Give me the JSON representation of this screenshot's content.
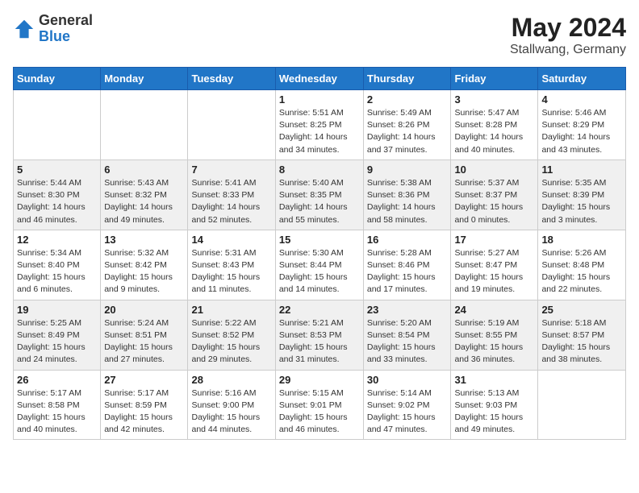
{
  "header": {
    "logo_general": "General",
    "logo_blue": "Blue",
    "month_year": "May 2024",
    "location": "Stallwang, Germany"
  },
  "days_of_week": [
    "Sunday",
    "Monday",
    "Tuesday",
    "Wednesday",
    "Thursday",
    "Friday",
    "Saturday"
  ],
  "weeks": [
    [
      {
        "day": "",
        "info": ""
      },
      {
        "day": "",
        "info": ""
      },
      {
        "day": "",
        "info": ""
      },
      {
        "day": "1",
        "info": "Sunrise: 5:51 AM\nSunset: 8:25 PM\nDaylight: 14 hours\nand 34 minutes."
      },
      {
        "day": "2",
        "info": "Sunrise: 5:49 AM\nSunset: 8:26 PM\nDaylight: 14 hours\nand 37 minutes."
      },
      {
        "day": "3",
        "info": "Sunrise: 5:47 AM\nSunset: 8:28 PM\nDaylight: 14 hours\nand 40 minutes."
      },
      {
        "day": "4",
        "info": "Sunrise: 5:46 AM\nSunset: 8:29 PM\nDaylight: 14 hours\nand 43 minutes."
      }
    ],
    [
      {
        "day": "5",
        "info": "Sunrise: 5:44 AM\nSunset: 8:30 PM\nDaylight: 14 hours\nand 46 minutes."
      },
      {
        "day": "6",
        "info": "Sunrise: 5:43 AM\nSunset: 8:32 PM\nDaylight: 14 hours\nand 49 minutes."
      },
      {
        "day": "7",
        "info": "Sunrise: 5:41 AM\nSunset: 8:33 PM\nDaylight: 14 hours\nand 52 minutes."
      },
      {
        "day": "8",
        "info": "Sunrise: 5:40 AM\nSunset: 8:35 PM\nDaylight: 14 hours\nand 55 minutes."
      },
      {
        "day": "9",
        "info": "Sunrise: 5:38 AM\nSunset: 8:36 PM\nDaylight: 14 hours\nand 58 minutes."
      },
      {
        "day": "10",
        "info": "Sunrise: 5:37 AM\nSunset: 8:37 PM\nDaylight: 15 hours\nand 0 minutes."
      },
      {
        "day": "11",
        "info": "Sunrise: 5:35 AM\nSunset: 8:39 PM\nDaylight: 15 hours\nand 3 minutes."
      }
    ],
    [
      {
        "day": "12",
        "info": "Sunrise: 5:34 AM\nSunset: 8:40 PM\nDaylight: 15 hours\nand 6 minutes."
      },
      {
        "day": "13",
        "info": "Sunrise: 5:32 AM\nSunset: 8:42 PM\nDaylight: 15 hours\nand 9 minutes."
      },
      {
        "day": "14",
        "info": "Sunrise: 5:31 AM\nSunset: 8:43 PM\nDaylight: 15 hours\nand 11 minutes."
      },
      {
        "day": "15",
        "info": "Sunrise: 5:30 AM\nSunset: 8:44 PM\nDaylight: 15 hours\nand 14 minutes."
      },
      {
        "day": "16",
        "info": "Sunrise: 5:28 AM\nSunset: 8:46 PM\nDaylight: 15 hours\nand 17 minutes."
      },
      {
        "day": "17",
        "info": "Sunrise: 5:27 AM\nSunset: 8:47 PM\nDaylight: 15 hours\nand 19 minutes."
      },
      {
        "day": "18",
        "info": "Sunrise: 5:26 AM\nSunset: 8:48 PM\nDaylight: 15 hours\nand 22 minutes."
      }
    ],
    [
      {
        "day": "19",
        "info": "Sunrise: 5:25 AM\nSunset: 8:49 PM\nDaylight: 15 hours\nand 24 minutes."
      },
      {
        "day": "20",
        "info": "Sunrise: 5:24 AM\nSunset: 8:51 PM\nDaylight: 15 hours\nand 27 minutes."
      },
      {
        "day": "21",
        "info": "Sunrise: 5:22 AM\nSunset: 8:52 PM\nDaylight: 15 hours\nand 29 minutes."
      },
      {
        "day": "22",
        "info": "Sunrise: 5:21 AM\nSunset: 8:53 PM\nDaylight: 15 hours\nand 31 minutes."
      },
      {
        "day": "23",
        "info": "Sunrise: 5:20 AM\nSunset: 8:54 PM\nDaylight: 15 hours\nand 33 minutes."
      },
      {
        "day": "24",
        "info": "Sunrise: 5:19 AM\nSunset: 8:55 PM\nDaylight: 15 hours\nand 36 minutes."
      },
      {
        "day": "25",
        "info": "Sunrise: 5:18 AM\nSunset: 8:57 PM\nDaylight: 15 hours\nand 38 minutes."
      }
    ],
    [
      {
        "day": "26",
        "info": "Sunrise: 5:17 AM\nSunset: 8:58 PM\nDaylight: 15 hours\nand 40 minutes."
      },
      {
        "day": "27",
        "info": "Sunrise: 5:17 AM\nSunset: 8:59 PM\nDaylight: 15 hours\nand 42 minutes."
      },
      {
        "day": "28",
        "info": "Sunrise: 5:16 AM\nSunset: 9:00 PM\nDaylight: 15 hours\nand 44 minutes."
      },
      {
        "day": "29",
        "info": "Sunrise: 5:15 AM\nSunset: 9:01 PM\nDaylight: 15 hours\nand 46 minutes."
      },
      {
        "day": "30",
        "info": "Sunrise: 5:14 AM\nSunset: 9:02 PM\nDaylight: 15 hours\nand 47 minutes."
      },
      {
        "day": "31",
        "info": "Sunrise: 5:13 AM\nSunset: 9:03 PM\nDaylight: 15 hours\nand 49 minutes."
      },
      {
        "day": "",
        "info": ""
      }
    ]
  ]
}
